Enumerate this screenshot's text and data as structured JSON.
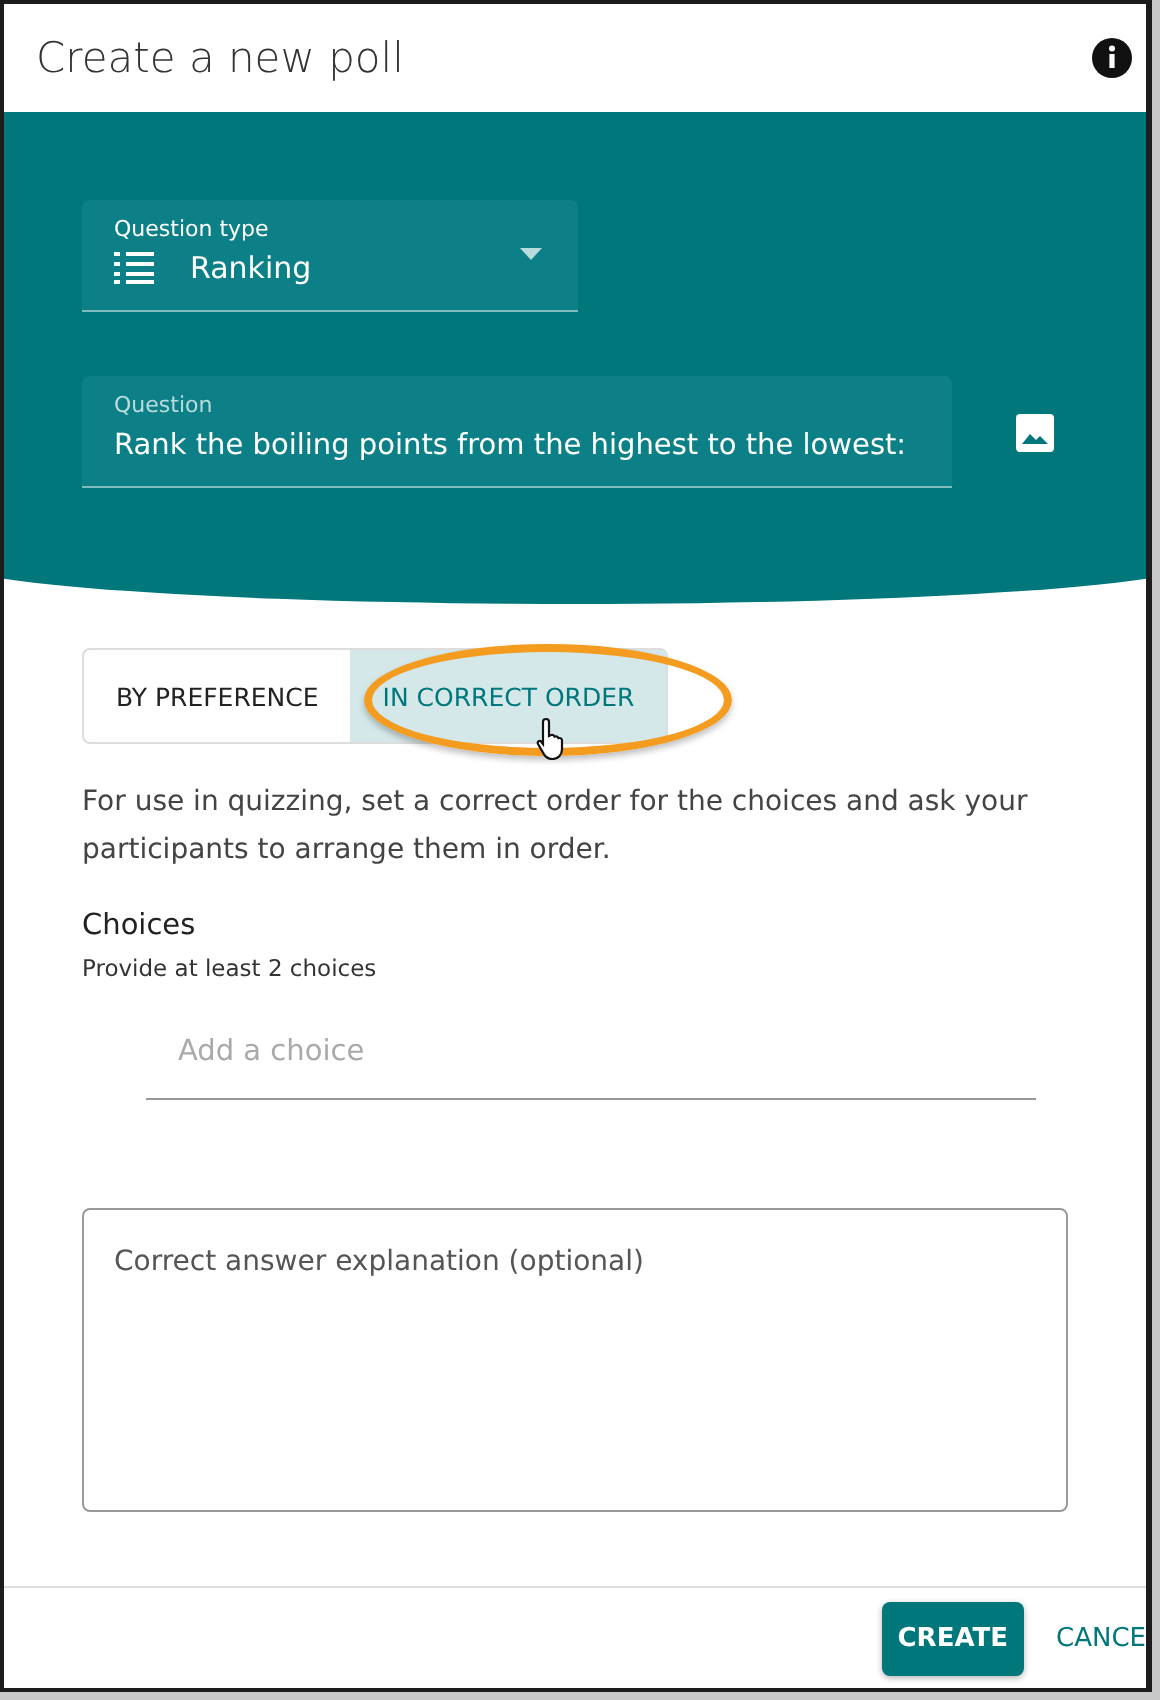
{
  "window": {
    "title": "Create a new poll"
  },
  "question_type": {
    "label": "Question type",
    "value": "Ranking"
  },
  "question": {
    "label": "Question",
    "value": "Rank the boiling points from the highest to the lowest:"
  },
  "mode_tabs": [
    {
      "label": "BY PREFERENCE",
      "selected": false
    },
    {
      "label": "IN CORRECT ORDER",
      "selected": true
    }
  ],
  "description": "For use in quizzing, set a correct order for the choices and ask your participants to arrange them in order.",
  "choices": {
    "heading": "Choices",
    "hint": "Provide at least 2 choices",
    "placeholder": "Add a choice"
  },
  "explanation": {
    "placeholder": "Correct answer explanation (optional)"
  },
  "buttons": [
    {
      "label": "CREATE",
      "kind": "primary"
    },
    {
      "label": "CANCE",
      "kind": "text"
    }
  ]
}
